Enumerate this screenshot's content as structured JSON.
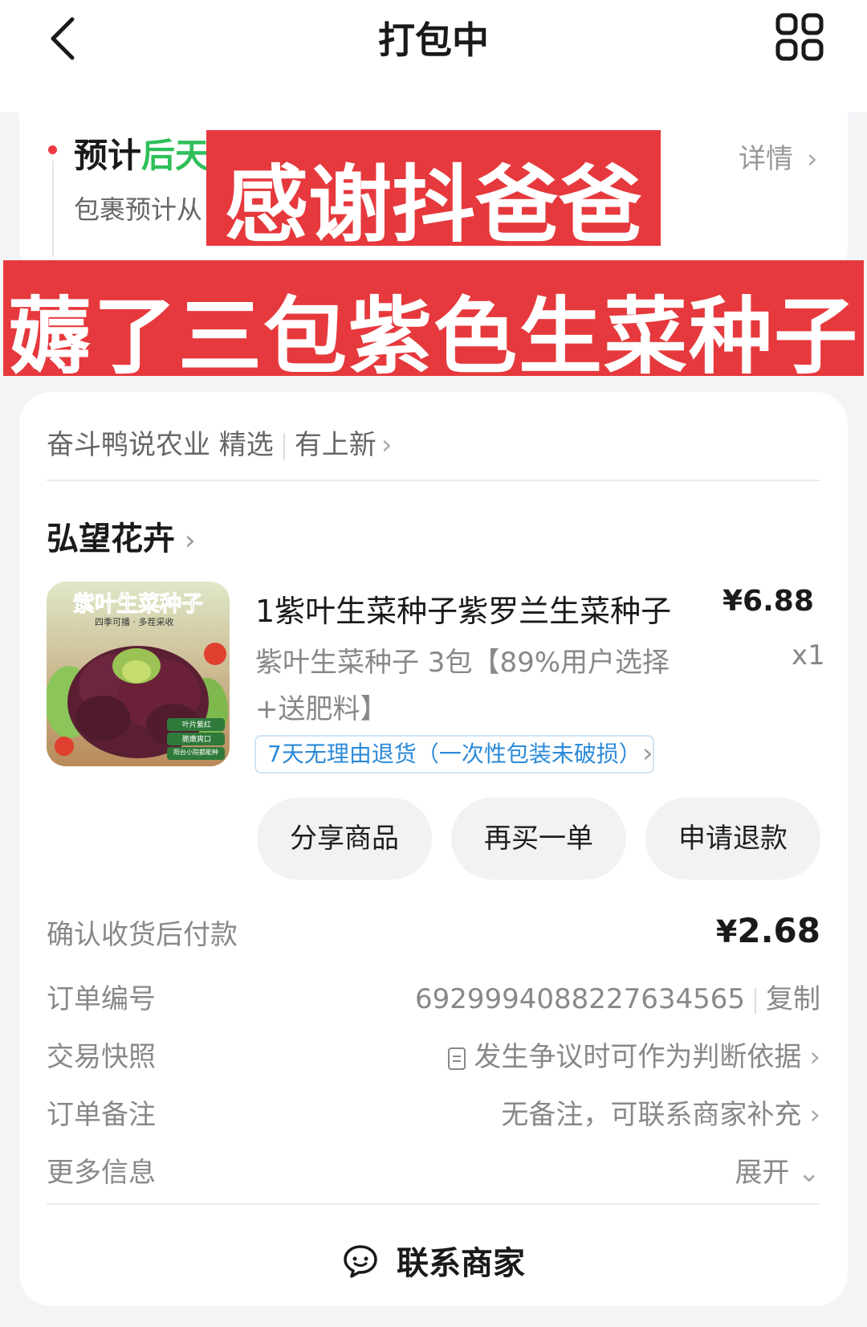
{
  "header": {
    "title": "打包中",
    "back_icon": "back-arrow-icon",
    "menu_icon": "grid-menu-icon"
  },
  "status": {
    "eta_prefix": "预计",
    "eta_highlight": "后天",
    "eta_sub": "包裹预计从",
    "detail_label": "详情"
  },
  "overlay": {
    "line1": "感谢抖爸爸",
    "line2": "薅了三包紫色生菜种子",
    "color": "#e6393d"
  },
  "store": {
    "name": "奋斗鸭说农业 精选",
    "new_label": "有上新"
  },
  "shop": {
    "name": "弘望花卉"
  },
  "product": {
    "image_title": "紫叶生菜种子",
    "image_subtitle": "四季可播 · 多茬采收",
    "image_tags": [
      "叶片紫红",
      "脆嫩爽口",
      "阳台小院都能种"
    ],
    "title": "1紫叶生菜种子紫罗兰生菜种子",
    "price": "¥6.88",
    "quantity": "x1",
    "spec_line1": "紫叶生菜种子 3包【89%用户选择",
    "spec_line2": "+送肥料】",
    "return_policy": "7天无理由退货（一次性包装未破损）"
  },
  "actions": {
    "share": "分享商品",
    "rebuy": "再买一单",
    "refund": "申请退款"
  },
  "payment": {
    "label": "确认收货后付款",
    "currency": "¥",
    "amount": "2.68"
  },
  "order_info": {
    "number_label": "订单编号",
    "number_value": "6929994088227634565",
    "copy_label": "复制",
    "snapshot_label": "交易快照",
    "snapshot_value": "发生争议时可作为判断依据",
    "remark_label": "订单备注",
    "remark_value": "无备注，可联系商家补充",
    "more_label": "更多信息",
    "more_value": "展开"
  },
  "contact": {
    "label": "联系商家",
    "icon": "chat-bubble-icon"
  },
  "colors": {
    "accent_red": "#f03a45",
    "green": "#2fbf5a",
    "link_blue": "#2b8ad8"
  }
}
